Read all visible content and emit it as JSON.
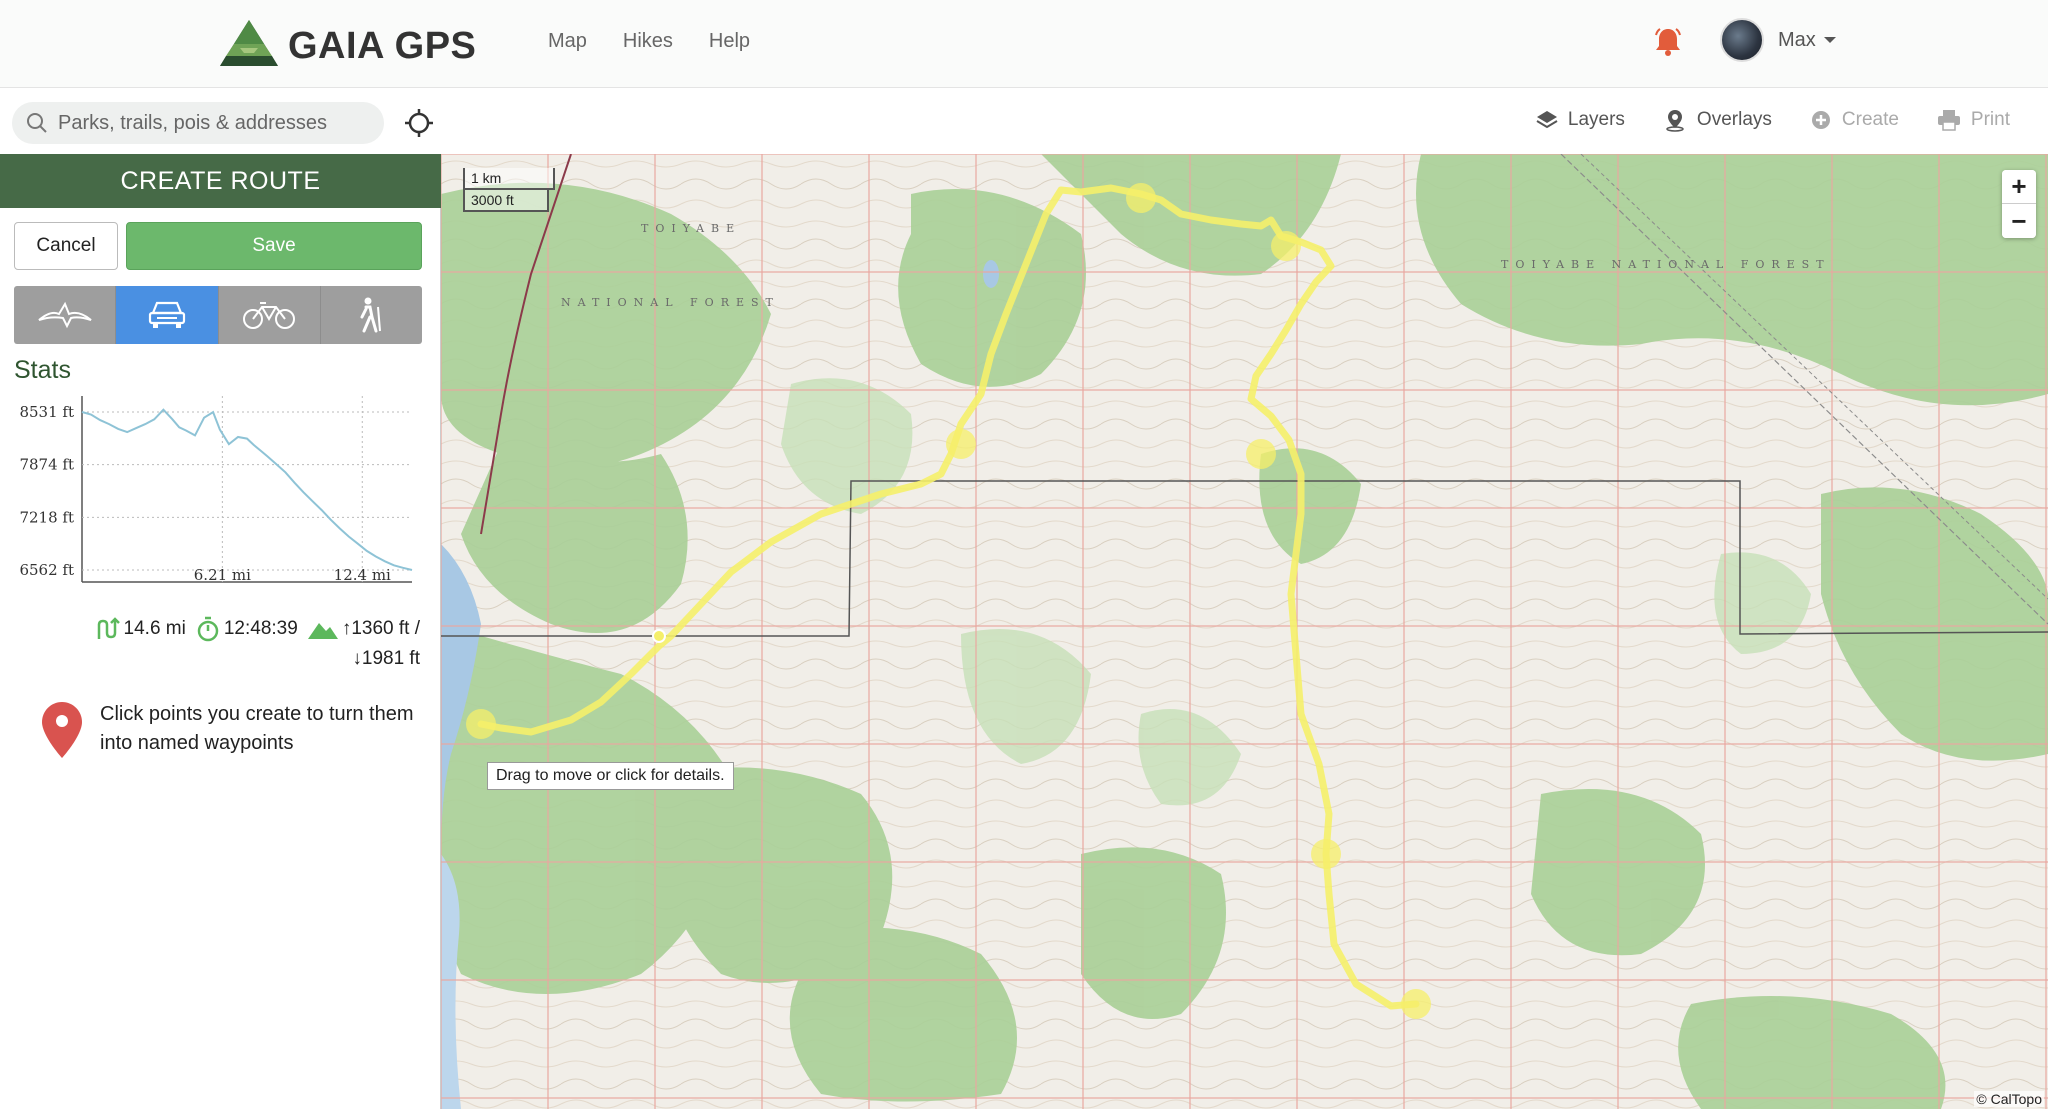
{
  "header": {
    "brand": "GAIA GPS",
    "nav": [
      "Map",
      "Hikes",
      "Help"
    ],
    "user_name": "Max"
  },
  "toolbar": {
    "search_placeholder": "Parks, trails, pois & addresses",
    "layers_label": "Layers",
    "overlays_label": "Overlays",
    "create_label": "Create",
    "print_label": "Print"
  },
  "panel": {
    "title": "CREATE ROUTE",
    "cancel_label": "Cancel",
    "save_label": "Save",
    "modes": [
      "straight-line",
      "drive",
      "bike",
      "hike"
    ],
    "active_mode": "drive",
    "stats_title": "Stats",
    "distance": "14.6 mi",
    "duration": "12:48:39",
    "ascent": "↑1360 ft /",
    "descent": "↓1981 ft",
    "hint": "Click points you create to turn them into named waypoints"
  },
  "chart_data": {
    "type": "line",
    "y_ticks": [
      "8531 ft",
      "7874 ft",
      "7218 ft",
      "6562 ft"
    ],
    "x_ticks": [
      "6.21 mi",
      "12.4 mi"
    ],
    "ylim": [
      6562,
      8531
    ],
    "xlim": [
      0,
      14.6
    ],
    "series": [
      {
        "x": [
          0,
          0.4,
          0.8,
          1.2,
          1.6,
          2.0,
          2.4,
          2.8,
          3.2,
          3.6,
          4.0,
          4.3,
          4.6,
          5.0,
          5.4,
          5.8,
          6.1,
          6.5,
          6.9,
          7.3,
          7.6,
          7.9,
          8.2,
          8.6,
          9.0,
          9.4,
          9.8,
          10.2,
          10.6,
          11.0,
          11.4,
          11.8,
          12.2,
          12.6,
          13.0,
          13.4,
          13.8,
          14.2,
          14.6
        ],
        "y": [
          8531,
          8500,
          8430,
          8380,
          8320,
          8280,
          8330,
          8380,
          8440,
          8560,
          8440,
          8340,
          8300,
          8240,
          8460,
          8530,
          8310,
          8130,
          8220,
          8200,
          8120,
          8050,
          7980,
          7880,
          7780,
          7650,
          7530,
          7420,
          7310,
          7190,
          7080,
          6980,
          6890,
          6800,
          6730,
          6670,
          6620,
          6590,
          6562
        ]
      }
    ],
    "line_color": "#8ec3d6"
  },
  "map": {
    "scale_km": "1 km",
    "scale_ft": "3000 ft",
    "tooltip": "Drag to move or click for details.",
    "attribution": "© CalTopo",
    "zoom_in": "+",
    "zoom_out": "−",
    "route_color": "#f5ef6a"
  }
}
